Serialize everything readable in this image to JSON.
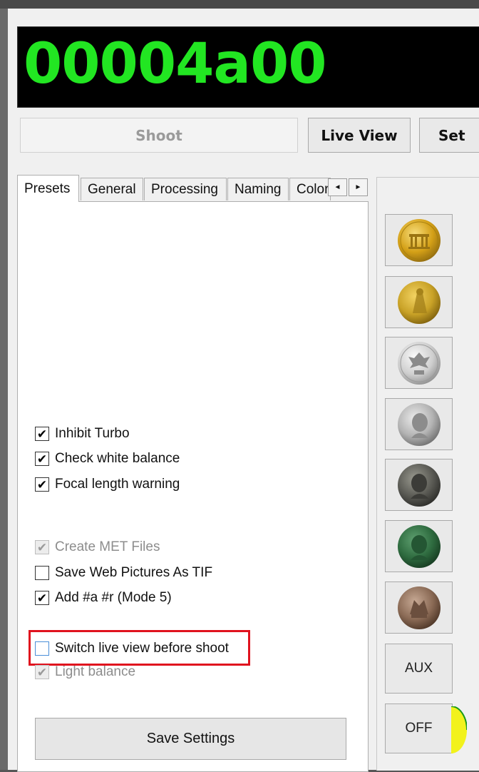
{
  "display": {
    "counter": "00004a00",
    "counter_color": "#22e622"
  },
  "toolbar": {
    "shoot_label": "Shoot",
    "live_view_label": "Live View",
    "set_label": "Set"
  },
  "tabs": [
    {
      "label": "Presets",
      "active": true
    },
    {
      "label": "General"
    },
    {
      "label": "Processing"
    },
    {
      "label": "Naming"
    },
    {
      "label": "Color"
    }
  ],
  "tab_scroll": {
    "left": "◄",
    "right": "►"
  },
  "options": [
    {
      "label": "Inhibit Turbo",
      "checked": true,
      "enabled": true
    },
    {
      "label": "Check white balance",
      "checked": true,
      "enabled": true
    },
    {
      "label": "Focal length warning",
      "checked": true,
      "enabled": true
    },
    {
      "label": "Create MET Files",
      "checked": true,
      "enabled": false
    },
    {
      "label": "Save Web Pictures As TIF",
      "checked": false,
      "enabled": true
    },
    {
      "label": "Add #a #r (Mode 5)",
      "checked": true,
      "enabled": true
    },
    {
      "label": "Switch live view before shoot",
      "checked": false,
      "enabled": true,
      "highlighted": true
    },
    {
      "label": "Light balance",
      "checked": true,
      "enabled": false
    }
  ],
  "save_settings_label": "Save Settings",
  "coins": [
    {
      "name": "gold-gate-coin-icon",
      "color": "#d4a017"
    },
    {
      "name": "gold-figure-coin-icon",
      "color": "#c9a227"
    },
    {
      "name": "silver-eagle-coin-icon",
      "color": "#c9c9c9"
    },
    {
      "name": "silver-portrait-coin-icon",
      "color": "#b3b3b3"
    },
    {
      "name": "dark-portrait-coin-icon",
      "color": "#5a5a54"
    },
    {
      "name": "green-portrait-coin-icon",
      "color": "#2e6b3f"
    },
    {
      "name": "bronze-figure-coin-icon",
      "color": "#8a6a55"
    }
  ],
  "aux_label": "AUX",
  "off_label": "OFF",
  "colors": {
    "highlight": "#e0121e",
    "indicator": "#f2f21c"
  }
}
